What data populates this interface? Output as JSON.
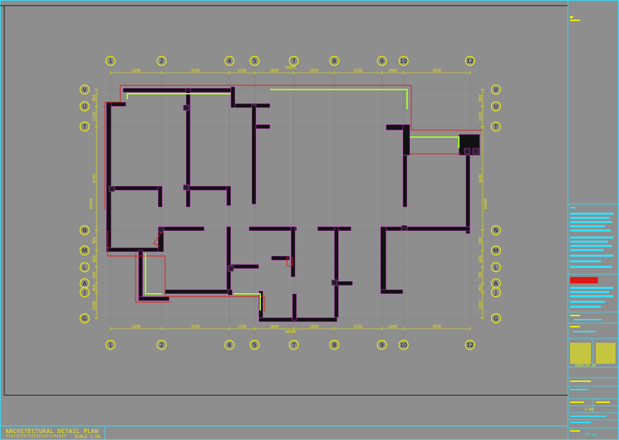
{
  "title_block": {
    "drawing_title": "ARCHITECTURAL DETAIL     PLAN",
    "drawing_subtitle": "????????????????????????",
    "scale_label": "SCALE  1:50",
    "drawing_number": "FP-03",
    "date": "2020.03.20",
    "scale_small": "1:50"
  },
  "grid_columns": [
    "1",
    "2",
    "4",
    "5",
    "7",
    "8",
    "9",
    "10",
    "12"
  ],
  "grid_rows": [
    "V",
    "U",
    "T",
    "N",
    "M",
    "L",
    "A",
    "J",
    "G"
  ],
  "dims_top": [
    "2300",
    "3100",
    "1100",
    "1600",
    "1850",
    "2150",
    "1060",
    "3000"
  ],
  "dims_top_total": "16300",
  "dims_bottom": [
    "2300",
    "3100",
    "1100",
    "1600",
    "1850",
    "2150",
    "1060",
    "3000"
  ],
  "dims_bottom_total": "16300",
  "dims_left": [
    "800",
    "1200",
    "4700",
    "900",
    "600",
    "700",
    "450",
    "1200"
  ],
  "dims_left_total": "10400",
  "dims_right": [
    "800",
    "1200",
    "4600",
    "900",
    "600",
    "700",
    "450",
    "1200"
  ],
  "dims_right_total": "10400",
  "colors": {
    "background": "#8e8e8e",
    "frame": "#33e0ff",
    "grid_bubble": "#f2f200",
    "wall": "#111111",
    "wall_hatch": "#ff40ff",
    "red_line": "#e01818",
    "green_line": "#a8ff20"
  }
}
